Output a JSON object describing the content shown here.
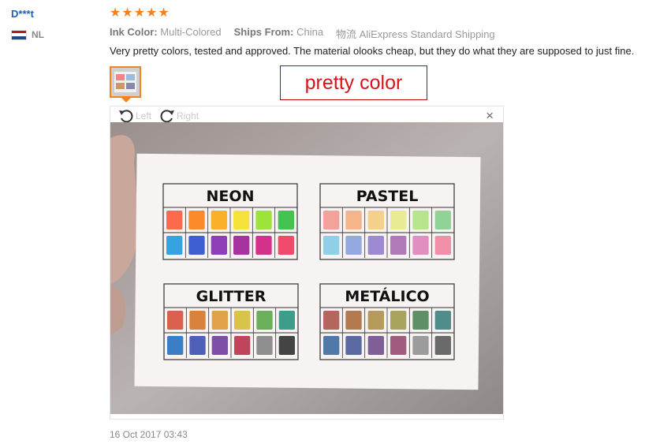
{
  "user": {
    "name": "D***t",
    "country_code": "NL",
    "flag_colors": [
      "#ae1c28",
      "#ffffff",
      "#21468b"
    ]
  },
  "rating": {
    "stars": 5,
    "star_color": "#f5821f"
  },
  "meta": {
    "ink_color_label": "Ink Color:",
    "ink_color_value": "Multi-Colored",
    "ships_from_label": "Ships From:",
    "ships_from_value": "China",
    "shipping": "物流 AliExpress Standard Shipping"
  },
  "review": {
    "text": "Very pretty colors, tested and approved. The material olooks cheap, but they do what they are supposed to just fine.",
    "date": "16 Oct 2017 03:43"
  },
  "annotation": {
    "text": "pretty color",
    "color": "#d7141a"
  },
  "viewer": {
    "rotate_left_label": "Left",
    "rotate_right_label": "Right",
    "close_symbol": "×",
    "photo": {
      "titles": [
        "NEON",
        "PASTEL",
        "GLITTER",
        "METÁLICO"
      ],
      "swatches": {
        "NEON": [
          [
            "#fb6a4a",
            "#fb8a2a",
            "#fbb02a",
            "#f5e33b",
            "#9ee23c",
            "#45c24f"
          ],
          [
            "#35a3e0",
            "#3e5fd1",
            "#8e3fb8",
            "#a534a0",
            "#d4318d",
            "#f04b6a"
          ]
        ],
        "PASTEL": [
          [
            "#f2a29a",
            "#f6b489",
            "#f5d08b",
            "#e8eb94",
            "#b6e58d",
            "#8fd496"
          ],
          [
            "#90cfe8",
            "#93a9df",
            "#9d8ad2",
            "#b07ab9",
            "#e08fc0",
            "#ef8fa8"
          ]
        ],
        "GLITTER": [
          [
            "#d9604e",
            "#d9823e",
            "#dfa24a",
            "#d9c34a",
            "#6ab05a",
            "#3c9e8a"
          ],
          [
            "#3a7fc6",
            "#4e5fb8",
            "#7e4fa6",
            "#c0445c",
            "#8f8f8f",
            "#444444"
          ]
        ],
        "METÁLICO": [
          [
            "#b4655e",
            "#b47a4e",
            "#b59a5a",
            "#a8a45e",
            "#5f8f64",
            "#4e8d8a"
          ],
          [
            "#4f79a8",
            "#5c6aa3",
            "#7e5f96",
            "#a05c7c",
            "#9c9c9c",
            "#6a6a6a"
          ]
        ]
      }
    }
  }
}
